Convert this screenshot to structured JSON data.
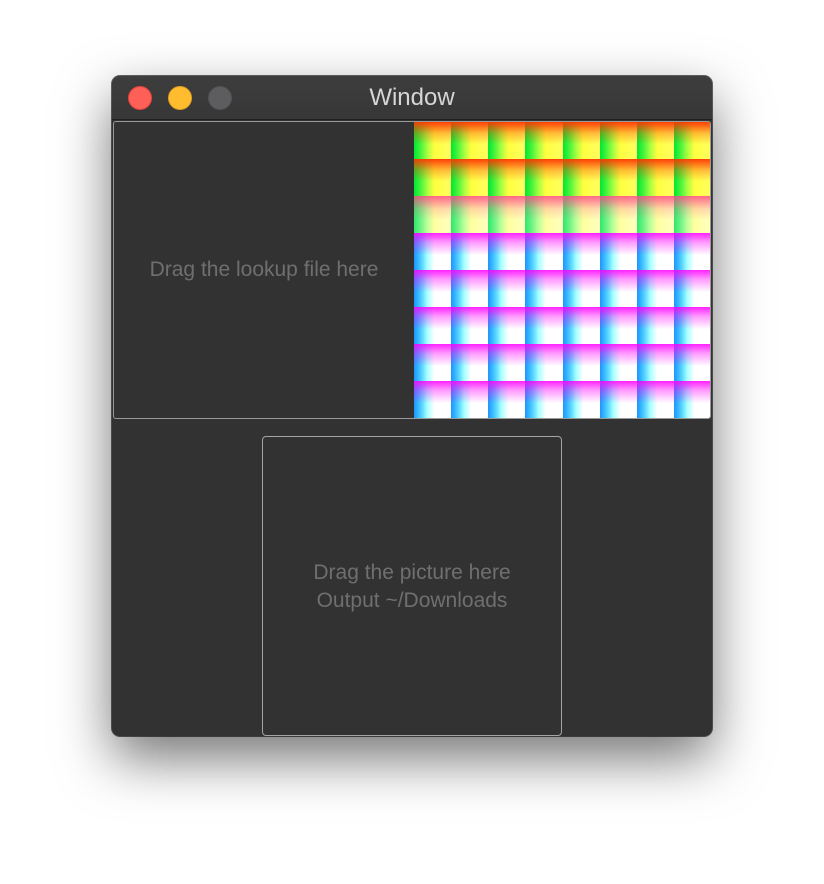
{
  "window": {
    "title": "Window",
    "traffic_lights": {
      "close_color": "#fe5f57",
      "minimize_color": "#febc2e",
      "zoom_color": "#5d5d60"
    }
  },
  "lookup_drop": {
    "label": "Drag the lookup file here",
    "preview": {
      "grid_rows": 8,
      "grid_cols": 8,
      "row_colors": [
        "#ff0000",
        "#ffff00",
        "#ffffff",
        "#ffffff",
        "#ffffff",
        "#ffffff",
        "#ffffff",
        "#ffffff"
      ],
      "cell_h_gradient": [
        "#00ff00",
        "#ffff00",
        "#ffffff"
      ],
      "row_tints": [
        "#ff3300",
        "#ff3300",
        "#ff4080",
        "#ff00ff",
        "#ff00ff",
        "#ff00ff",
        "#ff00ff",
        "#ff00ff"
      ]
    }
  },
  "picture_drop": {
    "line1": "Drag the picture here",
    "line2": "Output ~/Downloads"
  }
}
